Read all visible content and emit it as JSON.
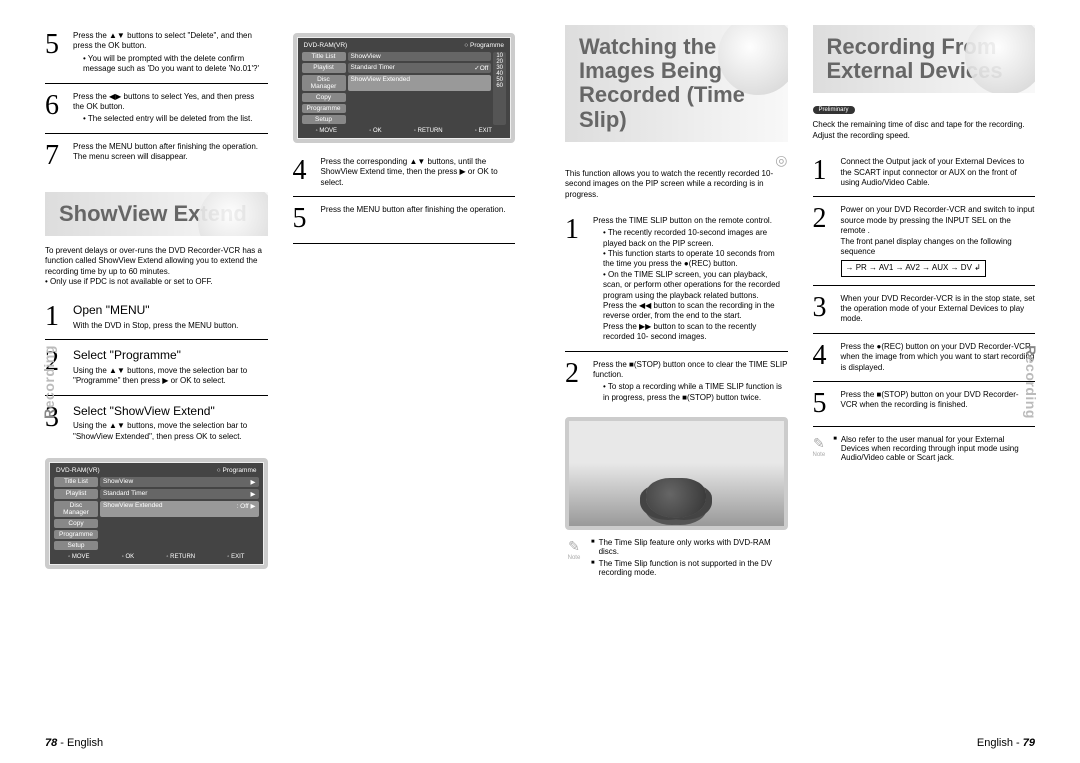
{
  "side_label": {
    "accent": "R",
    "rest": "ecording"
  },
  "footer": {
    "left_num": "78",
    "right_num": "79",
    "lang": "English",
    "sep": " - "
  },
  "left": {
    "colA": {
      "s5": {
        "num": "5",
        "main": "Press the ▲▼ buttons to select \"Delete\", and then press the OK button.",
        "bullets": [
          "You will be prompted with the delete confirm message such as 'Do you want to delete 'No.01'?'"
        ]
      },
      "s6": {
        "num": "6",
        "main": "Press the ◀▶ buttons to select Yes, and then press the OK button.",
        "bullets": [
          "The selected entry will be deleted from the list."
        ]
      },
      "s7": {
        "num": "7",
        "main": "Press the MENU button after finishing the operation. The menu screen will disappear."
      },
      "banner": "ShowView Extend",
      "intro": "To prevent delays or over-runs the DVD Recorder-VCR has a function called ShowView Extend allowing you to extend the recording time by up to 60 minutes.",
      "intro_b": "Only use if PDC is not available or set to OFF.",
      "s1": {
        "num": "1",
        "head": "Open \"MENU\"",
        "main": "With the DVD in Stop, press the MENU button."
      },
      "s2": {
        "num": "2",
        "head": "Select \"Programme\"",
        "main": "Using the ▲▼ buttons, move the selection bar to \"Programme\" then press ▶ or OK to select."
      },
      "s3": {
        "num": "3",
        "head": "Select \"ShowView Extend\"",
        "main": "Using the ▲▼ buttons, move the selection bar to \"ShowView Extended\", then press OK to select."
      }
    },
    "colB": {
      "s4": {
        "num": "4",
        "main": "Press the corresponding ▲▼ buttons, until the ShowView Extend time, then the press ▶ or OK to select."
      },
      "s5": {
        "num": "5",
        "main": "Press the MENU button after finishing the operation."
      }
    },
    "osd": {
      "header_l": "DVD-RAM(VR)",
      "header_r": "Programme",
      "rows": {
        "r1": {
          "l": "Title List",
          "m": "ShowView",
          "r": "▶"
        },
        "r2": {
          "l": "Playlist",
          "m": "Standard Timer",
          "r": "▶"
        },
        "r3": {
          "l": "Disc Manager",
          "m": "ShowView Extended",
          "r": ": Off ▶"
        },
        "r4": {
          "l": "Copy"
        },
        "r5": {
          "l": "Programme"
        },
        "r6": {
          "l": "Setup"
        }
      },
      "sv_opts": [
        "Off",
        "10",
        "20",
        "30",
        "40",
        "50",
        "60"
      ],
      "footer": {
        "a": "MOVE",
        "b": "OK",
        "c": "RETURN",
        "d": "EXIT"
      }
    }
  },
  "right": {
    "colA": {
      "banner": "Watching the Images Being Recorded (Time Slip)",
      "intro": "This function allows you to watch the recently recorded 10-second images on the PIP screen while a recording is in progress.",
      "s1": {
        "num": "1",
        "main": "Press the TIME SLIP button on the remote control.",
        "bullets": [
          "The recently recorded 10-second images are played back on the PIP screen.",
          "This function starts to operate 10 seconds from the time you press the ●(REC) button.",
          "On the TIME SLIP screen, you can playback, scan, or perform other operations for the recorded program using the playback related buttons.\nPress the ◀◀ button to scan the recording in the reverse order, from the end to the start.\nPress the ▶▶ button to scan to the recently recorded 10- second images."
        ]
      },
      "s2": {
        "num": "2",
        "main": "Press the ■(STOP) button once to clear the TIME SLIP function.",
        "bullets": [
          "To stop a recording while a TIME SLIP function is in progress, press the ■(STOP) button twice."
        ]
      },
      "notes": [
        "The Time Slip feature only works with DVD-RAM discs.",
        "The Time Slip function is not supported in the DV recording mode."
      ]
    },
    "colB": {
      "banner": "Recording From External Devices",
      "pill": "Preliminary",
      "intro": "Check the remaining time of disc and tape for the recording. Adjust the recording speed.",
      "s1": {
        "num": "1",
        "main": "Connect the Output jack of your External Devices to the SCART input connector or AUX on the front of using Audio/Video Cable."
      },
      "s2": {
        "num": "2",
        "main": "Power on your DVD Recorder-VCR and switch to input source mode by pressing the INPUT SEL on the remote .\nThe front panel display changes on the following sequence",
        "seq": "→ PR → AV1 → AV2 → AUX → DV ↲"
      },
      "s3": {
        "num": "3",
        "main": "When your DVD Recorder-VCR is in the stop state, set the operation mode of your External Devices to play mode."
      },
      "s4": {
        "num": "4",
        "main": "Press the ●(REC) button on your DVD Recorder-VCR when the image from which you want to start recording is displayed."
      },
      "s5": {
        "num": "5",
        "main": "Press the ■(STOP) button on your DVD Recorder-VCR when the recording is finished."
      },
      "notes": [
        "Also refer to the user manual for your External Devices when recording through input mode using Audio/Video cable or Scart jack."
      ]
    }
  },
  "note_label": "Note"
}
